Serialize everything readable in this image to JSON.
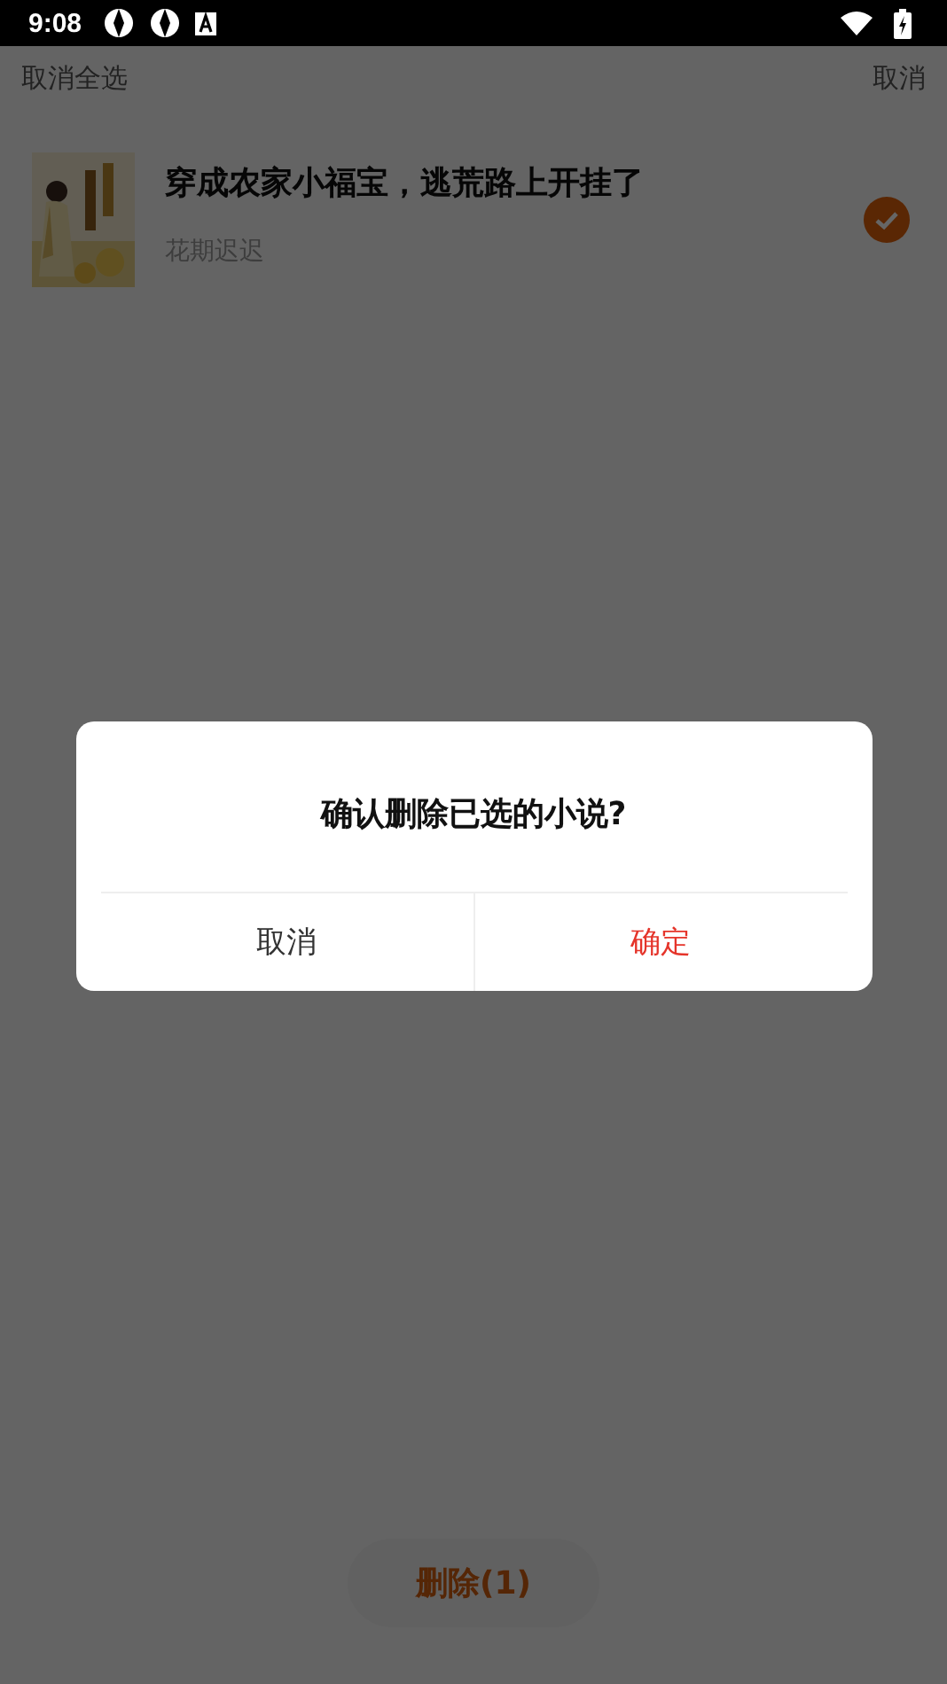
{
  "status_bar": {
    "time": "9:08"
  },
  "top_bar": {
    "left": "取消全选",
    "right": "取消"
  },
  "books": [
    {
      "title": "穿成农家小福宝，逃荒路上开挂了",
      "author": "花期迟迟",
      "selected": true
    }
  ],
  "dialog": {
    "message": "确认删除已选的小说?",
    "buttons": [
      {
        "label": "取消",
        "kind": "cancel"
      },
      {
        "label": "确定",
        "kind": "confirm"
      }
    ]
  },
  "delete_button": {
    "label": "删除(1)"
  }
}
